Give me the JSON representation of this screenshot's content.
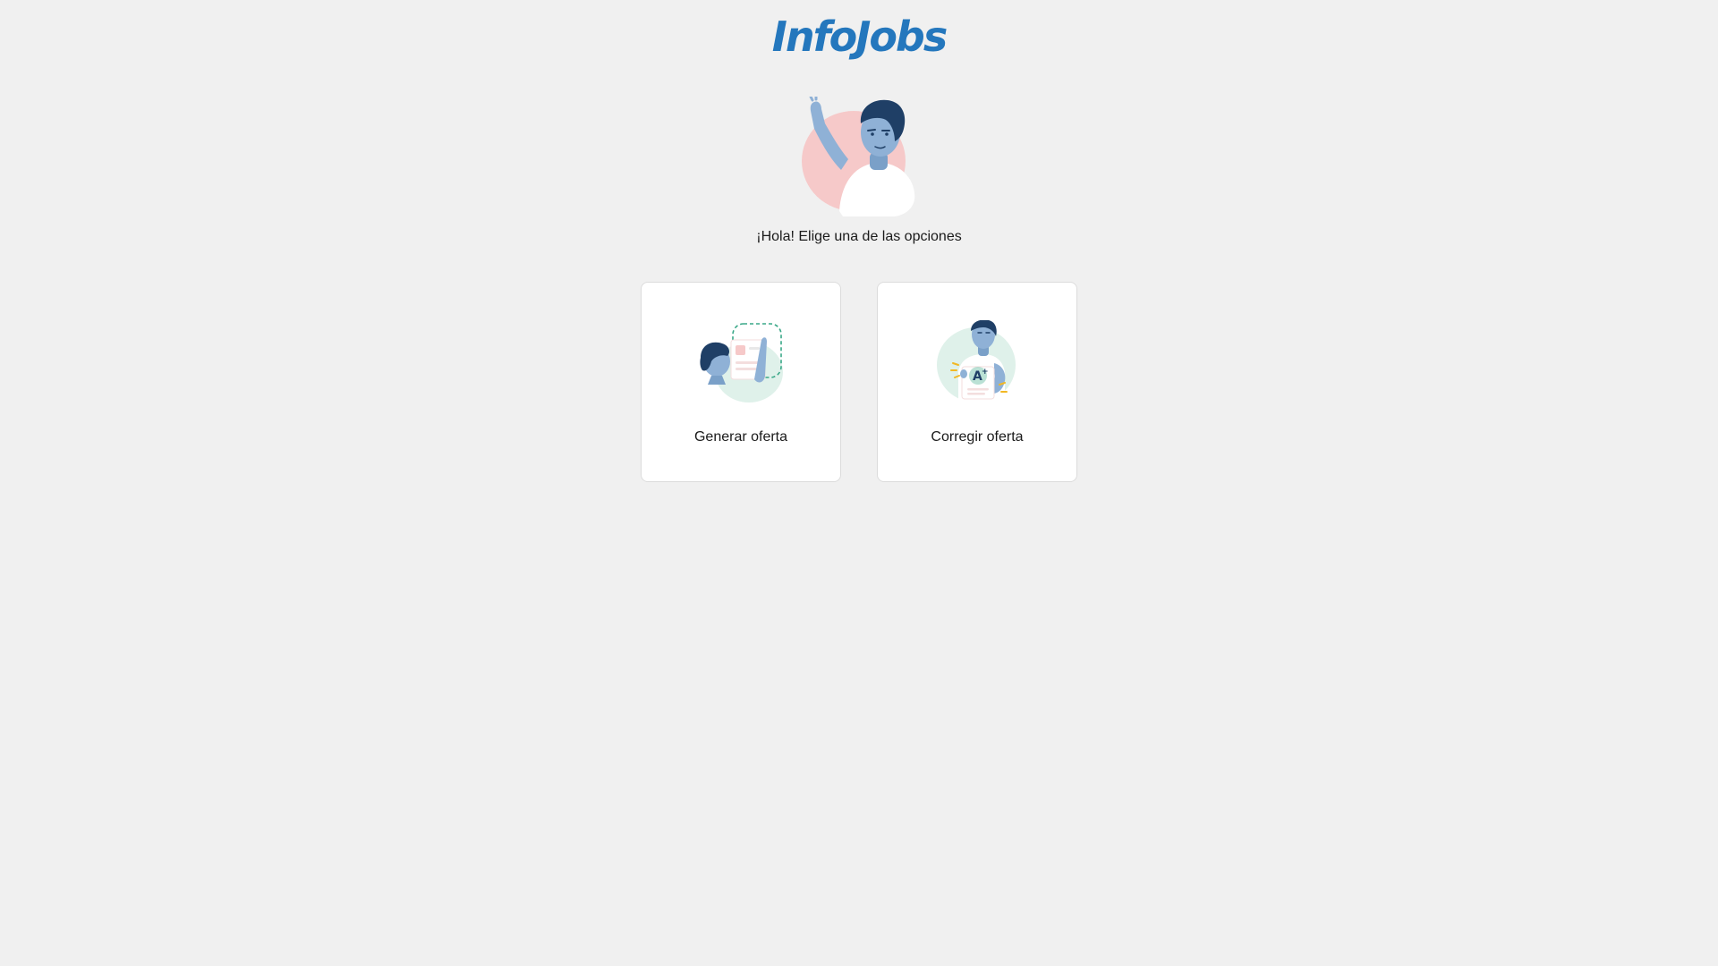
{
  "header": {
    "logo_text": "InfoJobs",
    "logo_color": "#2477bd"
  },
  "hero": {
    "illustration": "waving-person-icon",
    "greeting": "¡Hola! Elige una de las opciones"
  },
  "options": [
    {
      "label": "Generar oferta",
      "icon": "generate-offer-illustration-icon"
    },
    {
      "label": "Corregir oferta",
      "icon": "correct-offer-illustration-icon"
    }
  ],
  "colors": {
    "background": "#f0f0f0",
    "card": "#ffffff",
    "brand_blue": "#2477bd",
    "skin_blue": "#8fb1d6",
    "hair_navy": "#1f3f66",
    "accent_pink": "#f6c9c9",
    "accent_mint": "#dff1ea"
  }
}
